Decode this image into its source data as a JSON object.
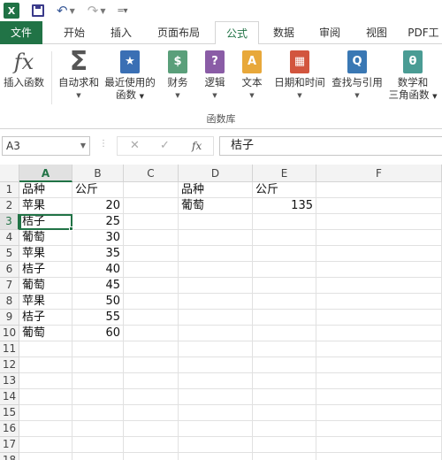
{
  "quick_access": {
    "app_icon": "excel-logo-icon",
    "app_letter": "X",
    "save": "save-icon",
    "undo": "undo-icon",
    "redo": "redo-icon",
    "customize": "customize-icon"
  },
  "tabs": [
    {
      "label": "文件",
      "name": "tab-file"
    },
    {
      "label": "开始",
      "name": "tab-home"
    },
    {
      "label": "插入",
      "name": "tab-insert"
    },
    {
      "label": "页面布局",
      "name": "tab-page-layout"
    },
    {
      "label": "公式",
      "name": "tab-formulas"
    },
    {
      "label": "数据",
      "name": "tab-data"
    },
    {
      "label": "审阅",
      "name": "tab-review"
    },
    {
      "label": "视图",
      "name": "tab-view"
    },
    {
      "label": "PDF工",
      "name": "tab-pdf"
    }
  ],
  "ribbon": {
    "insert_function": {
      "label": "插入函数",
      "icon": "fx"
    },
    "autosum": {
      "label": "自动求和",
      "icon": "Σ"
    },
    "recent": {
      "label1": "最近使用的",
      "label2": "函数",
      "icon": "★"
    },
    "financial": {
      "label": "财务",
      "icon": "$"
    },
    "logical": {
      "label": "逻辑",
      "icon": "?"
    },
    "text": {
      "label": "文本",
      "icon": "A"
    },
    "datetime": {
      "label": "日期和时间",
      "icon": "▦"
    },
    "lookup": {
      "label": "查找与引用",
      "icon": "Q"
    },
    "math": {
      "label1": "数学和",
      "label2": "三角函数",
      "icon": "θ"
    },
    "group_label": "函数库"
  },
  "formula_bar": {
    "name_box": "A3",
    "cancel": "✕",
    "enter": "✓",
    "fx": "fx",
    "value": "桔子"
  },
  "columns": [
    "A",
    "B",
    "C",
    "D",
    "E",
    "F"
  ],
  "rows": [
    "1",
    "2",
    "3",
    "4",
    "5",
    "6",
    "7",
    "8",
    "9",
    "10",
    "11",
    "12",
    "13",
    "14",
    "15",
    "16",
    "17",
    "18"
  ],
  "cells": {
    "A1": "品种",
    "B1": "公斤",
    "A2": "苹果",
    "B2": "20",
    "A3": "桔子",
    "B3": "25",
    "A4": "葡萄",
    "B4": "30",
    "A5": "苹果",
    "B5": "35",
    "A6": "桔子",
    "B6": "40",
    "A7": "葡萄",
    "B7": "45",
    "A8": "苹果",
    "B8": "50",
    "A9": "桔子",
    "B9": "55",
    "A10": "葡萄",
    "B10": "60",
    "D1": "品种",
    "E1": "公斤",
    "D2": "葡萄",
    "E2": "135"
  },
  "selected_cell": "A3",
  "colors": {
    "accent": "#217346"
  }
}
